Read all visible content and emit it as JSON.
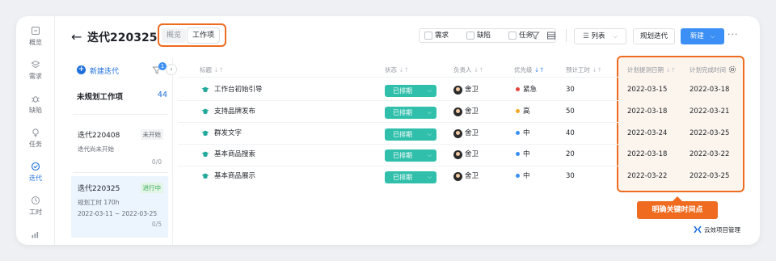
{
  "nav": {
    "items": [
      {
        "label": "概览",
        "icon": "overview-icon"
      },
      {
        "label": "需求",
        "icon": "requirement-icon"
      },
      {
        "label": "缺陷",
        "icon": "bug-icon"
      },
      {
        "label": "任务",
        "icon": "task-icon"
      },
      {
        "label": "迭代",
        "icon": "iteration-icon",
        "active": true
      },
      {
        "label": "工时",
        "icon": "clock-icon"
      },
      {
        "label": "",
        "icon": "chart-icon"
      }
    ]
  },
  "header": {
    "back_icon": "←",
    "title": "迭代220325",
    "view_tabs": [
      "概览",
      "工作项"
    ],
    "active_tab": "工作项",
    "filters": [
      "需求",
      "缺陷",
      "任务"
    ],
    "view_select": "列表",
    "plan_button": "规划迭代",
    "new_button": "新建",
    "more": "···"
  },
  "sidebar": {
    "new_iteration": "新建迭代",
    "filter_badge": "1",
    "collapse": "‹",
    "unplanned_label": "未规划工作项",
    "unplanned_count": "44",
    "iterations": [
      {
        "name": "迭代220408",
        "status": "未开始",
        "sub": "迭代尚未开始",
        "progress": "0/0"
      },
      {
        "name": "迭代220325",
        "status": "进行中",
        "sub": "规划工时 170h",
        "dates": "2022-03-11 ~ 2022-03-25",
        "progress": "0/5"
      }
    ]
  },
  "table": {
    "columns": [
      "标题",
      "状态",
      "负责人",
      "优先级",
      "预计工时",
      "计划提测日期",
      "计划完成时间"
    ],
    "rows": [
      {
        "title": "工作台初始引导",
        "status": "已排期",
        "owner": "舍卫",
        "priority": "紧急",
        "priority_color": "#e8453c",
        "hours": "30",
        "test_date": "2022-03-15",
        "finish_date": "2022-03-18"
      },
      {
        "title": "支持品牌发布",
        "status": "已排期",
        "owner": "舍卫",
        "priority": "高",
        "priority_color": "#f5a623",
        "hours": "50",
        "test_date": "2022-03-18",
        "finish_date": "2022-03-21"
      },
      {
        "title": "群发文字",
        "status": "已排期",
        "owner": "舍卫",
        "priority": "中",
        "priority_color": "#3b8ff5",
        "hours": "40",
        "test_date": "2022-03-24",
        "finish_date": "2022-03-25"
      },
      {
        "title": "基本商品搜索",
        "status": "已排期",
        "owner": "舍卫",
        "priority": "中",
        "priority_color": "#3b8ff5",
        "hours": "20",
        "test_date": "2022-03-18",
        "finish_date": "2022-03-22"
      },
      {
        "title": "基本商品展示",
        "status": "已排期",
        "owner": "舍卫",
        "priority": "中",
        "priority_color": "#3b8ff5",
        "hours": "30",
        "test_date": "2022-03-22",
        "finish_date": "2022-03-25"
      }
    ]
  },
  "annotation": {
    "callout": "明确关键时间点",
    "accent_color": "#ef6b1f"
  },
  "brand": "云效项目管理"
}
